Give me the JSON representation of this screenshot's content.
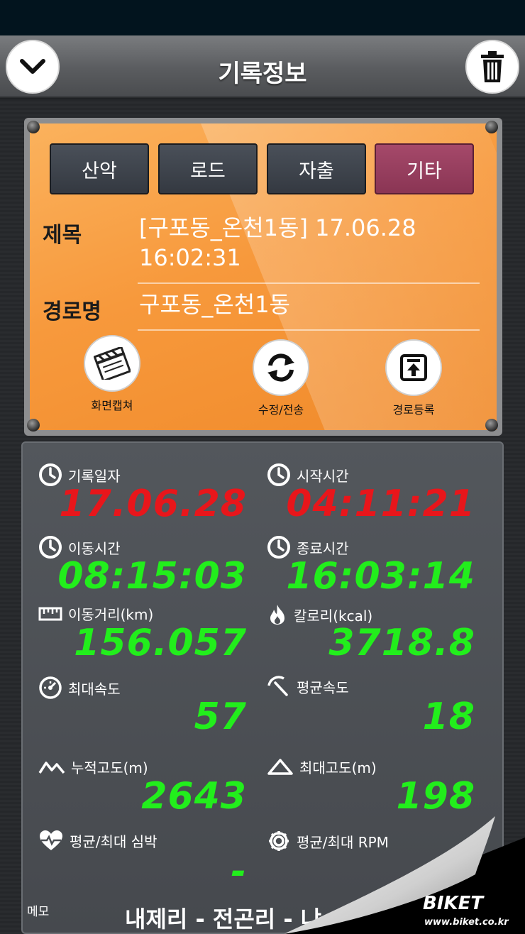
{
  "header": {
    "title": "기록정보",
    "back_icon": "chevron-down-icon",
    "trash_icon": "trash-icon"
  },
  "categories": [
    {
      "label": "산악",
      "active": false
    },
    {
      "label": "로드",
      "active": false
    },
    {
      "label": "자출",
      "active": false
    },
    {
      "label": "기타",
      "active": true
    }
  ],
  "record": {
    "title_label": "제목",
    "title_line1": "[구포동_온천1동] 17.06.28",
    "title_line2": "16:02:31",
    "route_label": "경로명",
    "route_value": "구포동_온천1동"
  },
  "actions": {
    "capture": "화면캡쳐",
    "edit_send": "수정/전송",
    "register_route": "경로등록"
  },
  "stats": {
    "record_date_label": "기록일자",
    "record_date": "17.06.28",
    "start_time_label": "시작시간",
    "start_time": "04:11:21",
    "moving_time_label": "이동시간",
    "moving_time": "08:15:03",
    "end_time_label": "종료시간",
    "end_time": "16:03:14",
    "distance_label": "이동거리(km)",
    "distance": "156.057",
    "calories_label": "칼로리(kcal)",
    "calories": "3718.8",
    "max_speed_label": "최대속도",
    "max_speed": "57",
    "avg_speed_label": "평균속도",
    "avg_speed": "18",
    "total_ascent_label": "누적고도(m)",
    "total_ascent": "2643",
    "max_altitude_label": "최대고도(m)",
    "max_altitude": "198",
    "heart_rate_label": "평균/최대 심박",
    "heart_rate": "-",
    "rpm_label": "평균/최대 RPM",
    "rpm": ""
  },
  "memo": {
    "label": "메모",
    "text": "내제리 - 전곤리 - 냐"
  },
  "watermark": {
    "brand": "BIKET",
    "url": "www.biket.co.kr"
  },
  "colors": {
    "red_value": "#e8161b",
    "green_value": "#22ee1c",
    "card_orange": "#f7993c",
    "active_tab": "#8a3554"
  }
}
